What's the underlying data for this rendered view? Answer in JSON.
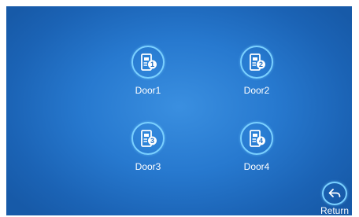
{
  "doors": [
    {
      "label": "Door1",
      "number": "1",
      "icon": "door-unlock-1-icon"
    },
    {
      "label": "Door2",
      "number": "2",
      "icon": "door-unlock-2-icon"
    },
    {
      "label": "Door3",
      "number": "3",
      "icon": "door-unlock-3-icon"
    },
    {
      "label": "Door4",
      "number": "4",
      "icon": "door-unlock-4-icon"
    }
  ],
  "return_button": {
    "label": "Return",
    "icon": "return-arrow-icon"
  },
  "colors": {
    "background": "#2779cf",
    "icon_ring": "#7ad0ff",
    "text": "#ffffff"
  }
}
